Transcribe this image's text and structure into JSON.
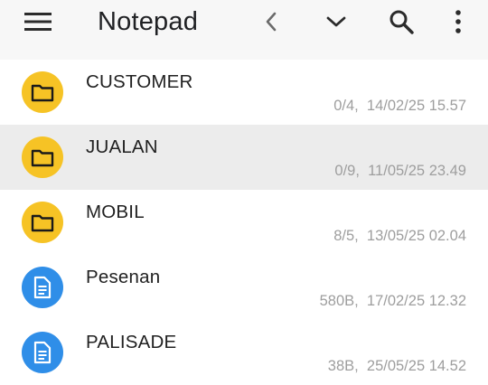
{
  "app": {
    "title": "Notepad"
  },
  "toolbar": {
    "menu_icon": "hamburger-menu-icon",
    "back_icon": "chevron-left-icon",
    "dropdown_icon": "chevron-down-icon",
    "search_icon": "search-icon",
    "more_icon": "more-vertical-icon"
  },
  "colors": {
    "folder_accent": "#f6c325",
    "document_accent": "#2f8ee8",
    "selected_row": "#ececec",
    "meta_text": "#9e9e9e"
  },
  "items": [
    {
      "name": "CUSTOMER",
      "type": "folder",
      "size": "0/4,",
      "date": "14/02/25 15.57",
      "selected": false
    },
    {
      "name": "JUALAN",
      "type": "folder",
      "size": "0/9,",
      "date": "11/05/25 23.49",
      "selected": true
    },
    {
      "name": "MOBIL",
      "type": "folder",
      "size": "8/5,",
      "date": "13/05/25 02.04",
      "selected": false
    },
    {
      "name": "Pesenan",
      "type": "document",
      "size": "580B,",
      "date": "17/02/25 12.32",
      "selected": false
    },
    {
      "name": "PALISADE",
      "type": "document",
      "size": "38B,",
      "date": "25/05/25 14.52",
      "selected": false
    }
  ]
}
